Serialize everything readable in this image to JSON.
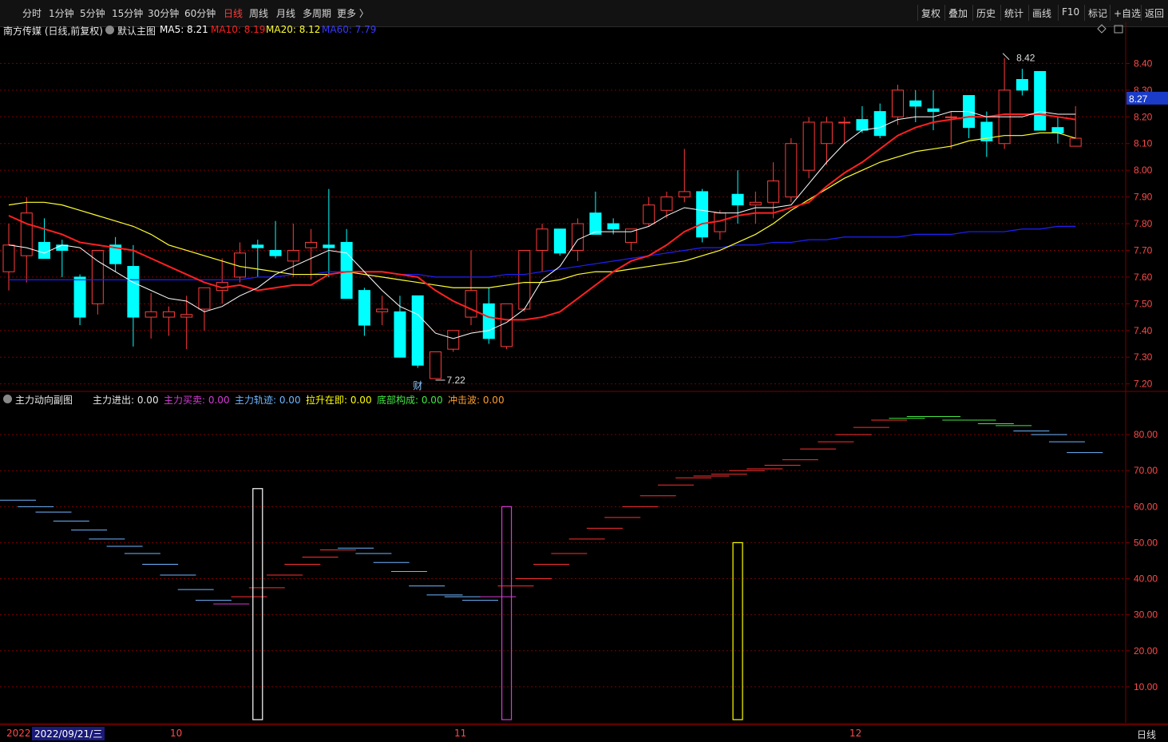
{
  "toolbar": {
    "periods": [
      "分时",
      "1分钟",
      "5分钟",
      "15分钟",
      "30分钟",
      "60分钟",
      "日线",
      "周线",
      "月线",
      "多周期",
      "更多 〉"
    ],
    "active_period": "日线",
    "tools": [
      "复权",
      "叠加",
      "历史",
      "统计",
      "画线",
      "F10",
      "标记",
      "+自选",
      "返回"
    ]
  },
  "main_panel": {
    "title": "南方传媒 (日线,前复权)",
    "theme": "默认主图",
    "ma5": "MA5: 8.21",
    "ma10": "MA10: 8.19",
    "ma20": "MA20: 8.12",
    "ma60": "MA60: 7.79",
    "current_price": "8.27",
    "high_label": "8.42",
    "low_label": "7.22",
    "event_marker": "财"
  },
  "sub_panel": {
    "title": "主力动向副图",
    "indicators": [
      {
        "label": "主力进出: 0.00",
        "color": "#e6e6e6"
      },
      {
        "label": "主力买卖: 0.00",
        "color": "#d63bd6"
      },
      {
        "label": "主力轨迹: 0.00",
        "color": "#6fb6ff"
      },
      {
        "label": "拉升在即: 0.00",
        "color": "#ffff00"
      },
      {
        "label": "底部构成: 0.00",
        "color": "#42e842"
      },
      {
        "label": "冲击波: 0.00",
        "color": "#ff9d2e"
      }
    ]
  },
  "bottom": {
    "date": "2022/09/21/三",
    "year_prefix": "2022",
    "months": [
      "10",
      "11",
      "12"
    ],
    "period_label": "日线"
  },
  "colors": {
    "up": "#ff3b3b",
    "down": "#00ffff",
    "ma5": "#ffffff",
    "ma10": "#ff2020",
    "ma20": "#ffff30",
    "ma60": "#2020ff",
    "grid": "#7a0000"
  },
  "chart_data": [
    {
      "type": "candlestick",
      "y_ticks": [
        "8.40",
        "8.30",
        "8.20",
        "8.10",
        "8.00",
        "7.90",
        "7.80",
        "7.70",
        "7.60",
        "7.50",
        "7.40",
        "7.30",
        "7.20"
      ],
      "ylim": [
        7.175,
        8.5
      ],
      "candles": [
        {
          "o": 7.62,
          "h": 7.8,
          "l": 7.55,
          "c": 7.72
        },
        {
          "o": 7.68,
          "h": 7.9,
          "l": 7.58,
          "c": 7.84
        },
        {
          "o": 7.73,
          "h": 7.82,
          "l": 7.67,
          "c": 7.67
        },
        {
          "o": 7.72,
          "h": 7.74,
          "l": 7.6,
          "c": 7.7
        },
        {
          "o": 7.6,
          "h": 7.61,
          "l": 7.42,
          "c": 7.45
        },
        {
          "o": 7.5,
          "h": 7.62,
          "l": 7.46,
          "c": 7.7
        },
        {
          "o": 7.72,
          "h": 7.75,
          "l": 7.62,
          "c": 7.65
        },
        {
          "o": 7.64,
          "h": 7.72,
          "l": 7.34,
          "c": 7.45
        },
        {
          "o": 7.45,
          "h": 7.54,
          "l": 7.37,
          "c": 7.47
        },
        {
          "o": 7.45,
          "h": 7.49,
          "l": 7.38,
          "c": 7.47
        },
        {
          "o": 7.45,
          "h": 7.53,
          "l": 7.33,
          "c": 7.46
        },
        {
          "o": 7.48,
          "h": 7.52,
          "l": 7.4,
          "c": 7.56
        },
        {
          "o": 7.55,
          "h": 7.67,
          "l": 7.5,
          "c": 7.58
        },
        {
          "o": 7.6,
          "h": 7.73,
          "l": 7.58,
          "c": 7.69
        },
        {
          "o": 7.72,
          "h": 7.74,
          "l": 7.6,
          "c": 7.71
        },
        {
          "o": 7.7,
          "h": 7.81,
          "l": 7.67,
          "c": 7.68
        },
        {
          "o": 7.66,
          "h": 7.8,
          "l": 7.6,
          "c": 7.7
        },
        {
          "o": 7.71,
          "h": 7.78,
          "l": 7.59,
          "c": 7.73
        },
        {
          "o": 7.72,
          "h": 7.93,
          "l": 7.6,
          "c": 7.71
        },
        {
          "o": 7.73,
          "h": 7.78,
          "l": 7.54,
          "c": 7.52
        },
        {
          "o": 7.55,
          "h": 7.56,
          "l": 7.38,
          "c": 7.42
        },
        {
          "o": 7.47,
          "h": 7.53,
          "l": 7.42,
          "c": 7.48
        },
        {
          "o": 7.47,
          "h": 7.53,
          "l": 7.3,
          "c": 7.3
        },
        {
          "o": 7.53,
          "h": 7.53,
          "l": 7.26,
          "c": 7.27
        },
        {
          "o": 7.22,
          "h": 7.32,
          "l": 7.22,
          "c": 7.32
        },
        {
          "o": 7.33,
          "h": 7.4,
          "l": 7.32,
          "c": 7.4
        },
        {
          "o": 7.45,
          "h": 7.7,
          "l": 7.42,
          "c": 7.55
        },
        {
          "o": 7.5,
          "h": 7.56,
          "l": 7.35,
          "c": 7.37
        },
        {
          "o": 7.34,
          "h": 7.5,
          "l": 7.33,
          "c": 7.5
        },
        {
          "o": 7.48,
          "h": 7.7,
          "l": 7.47,
          "c": 7.7
        },
        {
          "o": 7.7,
          "h": 7.8,
          "l": 7.62,
          "c": 7.78
        },
        {
          "o": 7.78,
          "h": 7.78,
          "l": 7.68,
          "c": 7.69
        },
        {
          "o": 7.7,
          "h": 7.82,
          "l": 7.66,
          "c": 7.8
        },
        {
          "o": 7.84,
          "h": 7.92,
          "l": 7.8,
          "c": 7.76
        },
        {
          "o": 7.8,
          "h": 7.82,
          "l": 7.76,
          "c": 7.78
        },
        {
          "o": 7.73,
          "h": 7.78,
          "l": 7.7,
          "c": 7.78
        },
        {
          "o": 7.8,
          "h": 7.9,
          "l": 7.79,
          "c": 7.87
        },
        {
          "o": 7.85,
          "h": 7.92,
          "l": 7.82,
          "c": 7.9
        },
        {
          "o": 7.9,
          "h": 8.08,
          "l": 7.88,
          "c": 7.92
        },
        {
          "o": 7.92,
          "h": 7.93,
          "l": 7.73,
          "c": 7.75
        },
        {
          "o": 7.77,
          "h": 7.85,
          "l": 7.74,
          "c": 7.84
        },
        {
          "o": 7.91,
          "h": 8.0,
          "l": 7.8,
          "c": 7.87
        },
        {
          "o": 7.87,
          "h": 7.92,
          "l": 7.8,
          "c": 7.88
        },
        {
          "o": 7.88,
          "h": 8.03,
          "l": 7.82,
          "c": 7.96
        },
        {
          "o": 7.9,
          "h": 8.12,
          "l": 7.88,
          "c": 8.1
        },
        {
          "o": 8.0,
          "h": 8.2,
          "l": 7.97,
          "c": 8.18
        },
        {
          "o": 8.1,
          "h": 8.2,
          "l": 8.02,
          "c": 8.18
        },
        {
          "o": 8.18,
          "h": 8.2,
          "l": 8.1,
          "c": 8.18
        },
        {
          "o": 8.19,
          "h": 8.24,
          "l": 8.14,
          "c": 8.15
        },
        {
          "o": 8.22,
          "h": 8.25,
          "l": 8.12,
          "c": 8.13
        },
        {
          "o": 8.2,
          "h": 8.32,
          "l": 8.17,
          "c": 8.3
        },
        {
          "o": 8.26,
          "h": 8.3,
          "l": 8.18,
          "c": 8.24
        },
        {
          "o": 8.23,
          "h": 8.3,
          "l": 8.15,
          "c": 8.22
        },
        {
          "o": 8.2,
          "h": 8.22,
          "l": 8.08,
          "c": 8.2
        },
        {
          "o": 8.28,
          "h": 8.28,
          "l": 8.12,
          "c": 8.16
        },
        {
          "o": 8.18,
          "h": 8.22,
          "l": 8.05,
          "c": 8.11
        },
        {
          "o": 8.1,
          "h": 8.42,
          "l": 8.08,
          "c": 8.3
        },
        {
          "o": 8.34,
          "h": 8.38,
          "l": 8.28,
          "c": 8.3
        },
        {
          "o": 8.37,
          "h": 8.37,
          "l": 8.15,
          "c": 8.15
        },
        {
          "o": 8.16,
          "h": 8.2,
          "l": 8.1,
          "c": 8.14
        },
        {
          "o": 8.09,
          "h": 8.24,
          "l": 8.09,
          "c": 8.12
        }
      ],
      "ma5": [
        7.72,
        7.71,
        7.69,
        7.72,
        7.71,
        7.66,
        7.62,
        7.58,
        7.55,
        7.52,
        7.51,
        7.47,
        7.49,
        7.53,
        7.56,
        7.61,
        7.64,
        7.67,
        7.7,
        7.69,
        7.62,
        7.55,
        7.49,
        7.46,
        7.39,
        7.37,
        7.39,
        7.4,
        7.43,
        7.48,
        7.59,
        7.64,
        7.74,
        7.77,
        7.77,
        7.77,
        7.79,
        7.83,
        7.86,
        7.85,
        7.84,
        7.84,
        7.86,
        7.86,
        7.87,
        7.95,
        8.03,
        8.1,
        8.15,
        8.16,
        8.19,
        8.2,
        8.2,
        8.22,
        8.22,
        8.2,
        8.2,
        8.2,
        8.22,
        8.21,
        8.21
      ],
      "ma10": [
        7.83,
        7.8,
        7.78,
        7.76,
        7.73,
        7.72,
        7.71,
        7.7,
        7.67,
        7.64,
        7.61,
        7.58,
        7.56,
        7.57,
        7.55,
        7.56,
        7.57,
        7.57,
        7.61,
        7.62,
        7.62,
        7.62,
        7.61,
        7.6,
        7.55,
        7.51,
        7.48,
        7.45,
        7.44,
        7.44,
        7.45,
        7.47,
        7.52,
        7.57,
        7.62,
        7.66,
        7.68,
        7.72,
        7.77,
        7.8,
        7.81,
        7.83,
        7.84,
        7.84,
        7.86,
        7.88,
        7.94,
        7.99,
        8.03,
        8.08,
        8.13,
        8.16,
        8.18,
        8.19,
        8.2,
        8.2,
        8.21,
        8.21,
        8.21,
        8.2,
        8.19
      ],
      "ma20": [
        7.87,
        7.88,
        7.88,
        7.87,
        7.85,
        7.83,
        7.81,
        7.79,
        7.76,
        7.72,
        7.7,
        7.68,
        7.66,
        7.64,
        7.63,
        7.62,
        7.61,
        7.61,
        7.61,
        7.62,
        7.61,
        7.6,
        7.59,
        7.58,
        7.57,
        7.56,
        7.56,
        7.56,
        7.57,
        7.58,
        7.58,
        7.59,
        7.61,
        7.62,
        7.62,
        7.63,
        7.64,
        7.65,
        7.66,
        7.68,
        7.7,
        7.73,
        7.76,
        7.8,
        7.85,
        7.89,
        7.93,
        7.97,
        8.0,
        8.03,
        8.05,
        8.07,
        8.08,
        8.09,
        8.11,
        8.12,
        8.13,
        8.13,
        8.14,
        8.14,
        8.12
      ],
      "ma60": [
        7.59,
        7.59,
        7.59,
        7.59,
        7.59,
        7.59,
        7.59,
        7.59,
        7.59,
        7.59,
        7.59,
        7.59,
        7.59,
        7.59,
        7.6,
        7.6,
        7.61,
        7.61,
        7.62,
        7.62,
        7.62,
        7.62,
        7.61,
        7.61,
        7.6,
        7.6,
        7.6,
        7.6,
        7.61,
        7.61,
        7.62,
        7.63,
        7.64,
        7.65,
        7.66,
        7.67,
        7.68,
        7.69,
        7.7,
        7.71,
        7.71,
        7.72,
        7.72,
        7.73,
        7.73,
        7.74,
        7.74,
        7.75,
        7.75,
        7.75,
        7.75,
        7.76,
        7.76,
        7.76,
        7.77,
        7.77,
        7.77,
        7.78,
        7.78,
        7.79,
        7.79
      ]
    },
    {
      "type": "step-indicator",
      "y_ticks": [
        "80.00",
        "70.00",
        "60.00",
        "50.00",
        "40.00",
        "30.00",
        "20.00",
        "10.00"
      ],
      "ylim": [
        0,
        88
      ],
      "trajectory_segments": [
        {
          "x": 0,
          "v": 61.8,
          "c": "#6fb6ff"
        },
        {
          "x": 1,
          "v": 60,
          "c": "#6fb6ff"
        },
        {
          "x": 2,
          "v": 58.5,
          "c": "#6fb6ff"
        },
        {
          "x": 3,
          "v": 56,
          "c": "#6fb6ff"
        },
        {
          "x": 4,
          "v": 53.5,
          "c": "#6fb6ff"
        },
        {
          "x": 5,
          "v": 51,
          "c": "#6fb6ff"
        },
        {
          "x": 6,
          "v": 49,
          "c": "#6fb6ff"
        },
        {
          "x": 7,
          "v": 47,
          "c": "#6fb6ff"
        },
        {
          "x": 8,
          "v": 44,
          "c": "#6fb6ff"
        },
        {
          "x": 9,
          "v": 41,
          "c": "#6fb6ff"
        },
        {
          "x": 10,
          "v": 37,
          "c": "#6fb6ff"
        },
        {
          "x": 11,
          "v": 34,
          "c": "#6fb6ff"
        },
        {
          "x": 12,
          "v": 33,
          "c": "#d63bd6"
        },
        {
          "x": 13,
          "v": 35,
          "c": "#ff3030"
        },
        {
          "x": 14,
          "v": 37.5,
          "c": "#ff3030"
        },
        {
          "x": 15,
          "v": 41,
          "c": "#ff3030"
        },
        {
          "x": 16,
          "v": 44,
          "c": "#ff3030"
        },
        {
          "x": 17,
          "v": 46,
          "c": "#ff3030"
        },
        {
          "x": 18,
          "v": 48,
          "c": "#ff3030"
        },
        {
          "x": 19,
          "v": 48.5,
          "c": "#6fb6ff"
        },
        {
          "x": 20,
          "v": 47,
          "c": "#6fb6ff"
        },
        {
          "x": 21,
          "v": 44.5,
          "c": "#6fb6ff"
        },
        {
          "x": 22,
          "v": 42,
          "c": "#6fb6ff"
        },
        {
          "x": 23,
          "v": 38,
          "c": "#6fb6ff"
        },
        {
          "x": 24,
          "v": 35.5,
          "c": "#6fb6ff"
        },
        {
          "x": 25,
          "v": 35,
          "c": "#6fb6ff"
        },
        {
          "x": 26,
          "v": 34,
          "c": "#6fb6ff"
        },
        {
          "x": 27,
          "v": 35,
          "c": "#d63bd6"
        },
        {
          "x": 28,
          "v": 38,
          "c": "#ff3030"
        },
        {
          "x": 29,
          "v": 40,
          "c": "#ff3030"
        },
        {
          "x": 30,
          "v": 44,
          "c": "#ff3030"
        },
        {
          "x": 31,
          "v": 47,
          "c": "#ff3030"
        },
        {
          "x": 32,
          "v": 51,
          "c": "#ff3030"
        },
        {
          "x": 33,
          "v": 54,
          "c": "#ff3030"
        },
        {
          "x": 34,
          "v": 57,
          "c": "#ff3030"
        },
        {
          "x": 35,
          "v": 60,
          "c": "#ff3030"
        },
        {
          "x": 36,
          "v": 63,
          "c": "#ff3030"
        },
        {
          "x": 37,
          "v": 66,
          "c": "#ff3030"
        },
        {
          "x": 38,
          "v": 68,
          "c": "#ff3030"
        },
        {
          "x": 39,
          "v": 68.5,
          "c": "#ff3030"
        },
        {
          "x": 40,
          "v": 69,
          "c": "#ff3030"
        },
        {
          "x": 41,
          "v": 70,
          "c": "#ff3030"
        },
        {
          "x": 42,
          "v": 70.5,
          "c": "#ff3030"
        },
        {
          "x": 43,
          "v": 71.5,
          "c": "#ff3030"
        },
        {
          "x": 44,
          "v": 73,
          "c": "#ff3030"
        },
        {
          "x": 45,
          "v": 76,
          "c": "#ff3030"
        },
        {
          "x": 46,
          "v": 78,
          "c": "#ff3030"
        },
        {
          "x": 47,
          "v": 80,
          "c": "#ff3030"
        },
        {
          "x": 48,
          "v": 82,
          "c": "#ff3030"
        },
        {
          "x": 49,
          "v": 84,
          "c": "#ff3030"
        },
        {
          "x": 50,
          "v": 84.5,
          "c": "#42e842"
        },
        {
          "x": 51,
          "v": 85,
          "c": "#42e842"
        },
        {
          "x": 52,
          "v": 85,
          "c": "#42e842"
        },
        {
          "x": 53,
          "v": 84,
          "c": "#42e842"
        },
        {
          "x": 54,
          "v": 84,
          "c": "#42e842"
        },
        {
          "x": 55,
          "v": 83,
          "c": "#42e842"
        },
        {
          "x": 56,
          "v": 82.5,
          "c": "#42e842"
        },
        {
          "x": 57,
          "v": 81,
          "c": "#6fb6ff"
        },
        {
          "x": 58,
          "v": 80,
          "c": "#6fb6ff"
        },
        {
          "x": 59,
          "v": 78,
          "c": "#6fb6ff"
        },
        {
          "x": 60,
          "v": 75,
          "c": "#6fb6ff"
        }
      ],
      "bars": [
        {
          "x": 14,
          "value": 65,
          "color": "#ffffff"
        },
        {
          "x": 28,
          "value": 60,
          "color": "#d63bd6"
        },
        {
          "x": 41,
          "value": 50,
          "color": "#ffff00"
        }
      ]
    }
  ]
}
